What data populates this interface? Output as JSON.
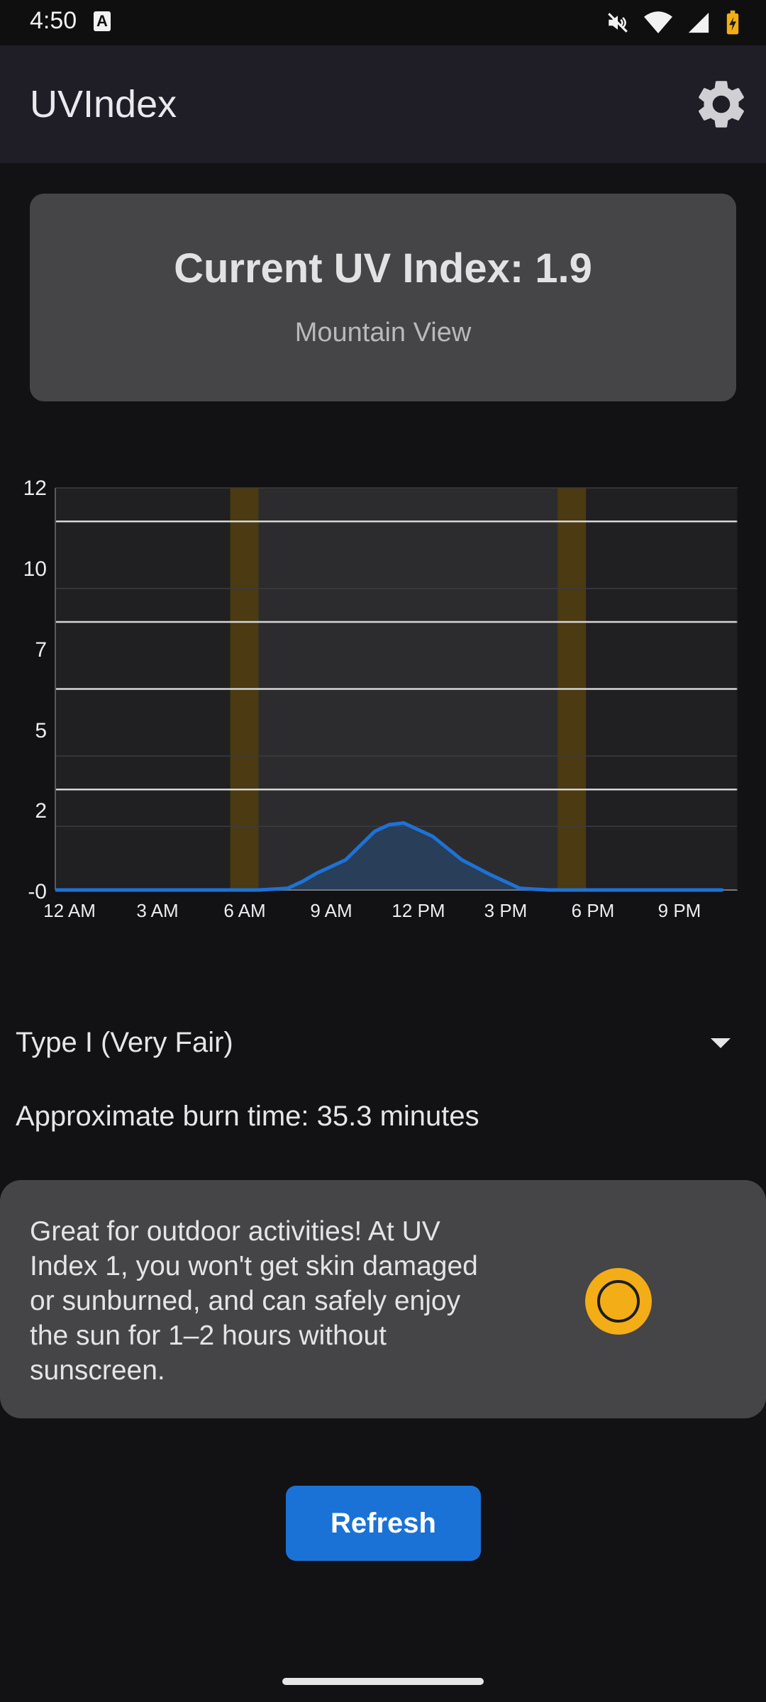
{
  "status_bar": {
    "time": "4:50",
    "a_label": "A"
  },
  "app_bar": {
    "title": "UVIndex"
  },
  "uv_card": {
    "title": "Current UV Index: 1.9",
    "location": "Mountain View"
  },
  "chart_data": {
    "type": "area",
    "title": "",
    "xlabel": "",
    "ylabel": "",
    "y_tick_labels": [
      "12",
      "10",
      "7",
      "5",
      "2",
      "-0"
    ],
    "x_tick_labels": [
      "12 AM",
      "3 AM",
      "6 AM",
      "9 AM",
      "12 PM",
      "3 PM",
      "6 PM",
      "9 PM"
    ],
    "x_hours": [
      0,
      1,
      2,
      3,
      4,
      5,
      6,
      7,
      8,
      8.5,
      9,
      10,
      11,
      11.5,
      12,
      13,
      14,
      15,
      16,
      17,
      18,
      19,
      20,
      21,
      22,
      23
    ],
    "values": [
      0,
      0,
      0,
      0,
      0,
      0,
      0,
      0,
      0.05,
      0.25,
      0.5,
      0.9,
      1.75,
      1.95,
      2.0,
      1.6,
      0.9,
      0.45,
      0.05,
      0,
      0,
      0,
      0,
      0,
      0,
      0
    ],
    "ylim": [
      0,
      12
    ],
    "xlim_hours": [
      0,
      23.5
    ],
    "threshold_lines": [
      3,
      6,
      8,
      11
    ],
    "daylight_hours": [
      7,
      17.3
    ],
    "sunrise_hour": 7,
    "sunset_hour": 17.3,
    "series_color": "#1d72d6",
    "grid": true
  },
  "skin_type": {
    "label": "Type I (Very Fair)"
  },
  "burn_time": "Approximate burn time: 35.3 minutes",
  "advice": {
    "text": "Great for outdoor activities! At UV Index 1, you won't get skin damaged or sunburned, and can safely enjoy the sun for 1–2 hours without sunscreen.",
    "icon": "sun-icon",
    "icon_color": "#f3ad16"
  },
  "refresh_label": "Refresh",
  "colors": {
    "accent": "#1b72d6",
    "card": "#454446",
    "background": "#121113",
    "app_bar": "#1f1e26"
  }
}
